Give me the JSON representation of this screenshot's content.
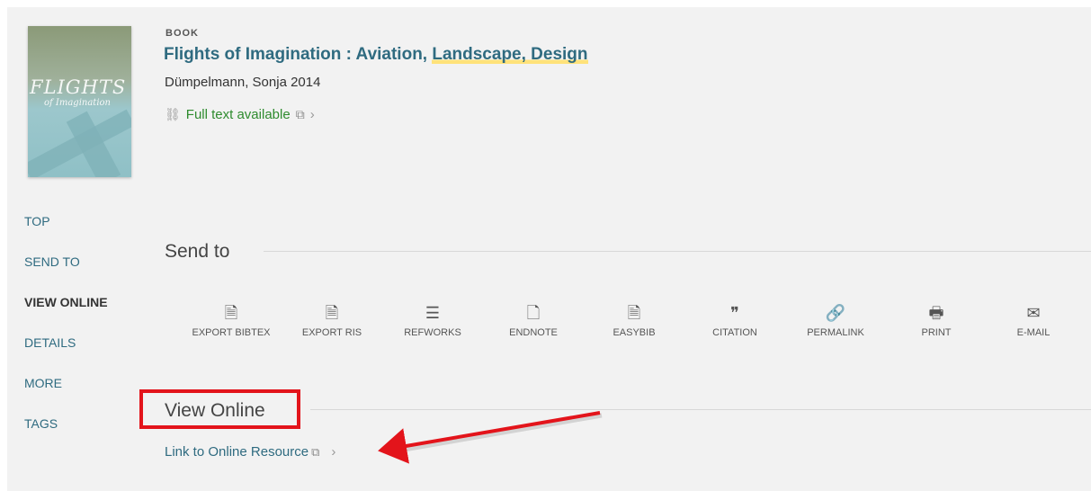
{
  "record": {
    "type": "BOOK",
    "title_main": "Flights of Imagination : Aviation, ",
    "title_highlight": "Landscape, Design",
    "author": "Dümpelmann, Sonja 2014",
    "full_text": "Full text available",
    "cover": {
      "title": "FLIGHTS",
      "subtitle": "of Imagination"
    }
  },
  "sidenav": [
    "TOP",
    "SEND TO",
    "VIEW ONLINE",
    "DETAILS",
    "MORE",
    "TAGS"
  ],
  "send_to": {
    "heading": "Send to",
    "actions": [
      {
        "label": "EXPORT BIBTEX",
        "icon": "export-bibtex-icon",
        "glyph": "🗎"
      },
      {
        "label": "EXPORT RIS",
        "icon": "export-ris-icon",
        "glyph": "🗎"
      },
      {
        "label": "REFWORKS",
        "icon": "refworks-icon",
        "glyph": "☰"
      },
      {
        "label": "ENDNOTE",
        "icon": "endnote-icon",
        "glyph": "🗋"
      },
      {
        "label": "EASYBIB",
        "icon": "easybib-icon",
        "glyph": "🗎"
      },
      {
        "label": "CITATION",
        "icon": "citation-icon",
        "glyph": "❞"
      },
      {
        "label": "PERMALINK",
        "icon": "permalink-icon",
        "glyph": "🔗"
      },
      {
        "label": "PRINT",
        "icon": "print-icon",
        "glyph": "🖶"
      },
      {
        "label": "E-MAIL",
        "icon": "email-icon",
        "glyph": "✉"
      }
    ]
  },
  "view_online": {
    "heading": "View Online",
    "link_label": "Link to Online Resource"
  },
  "colors": {
    "link": "#2f6b80",
    "full_text": "#2e8b2e",
    "annotation_red": "#e3141b",
    "highlight": "#ffe27a"
  }
}
